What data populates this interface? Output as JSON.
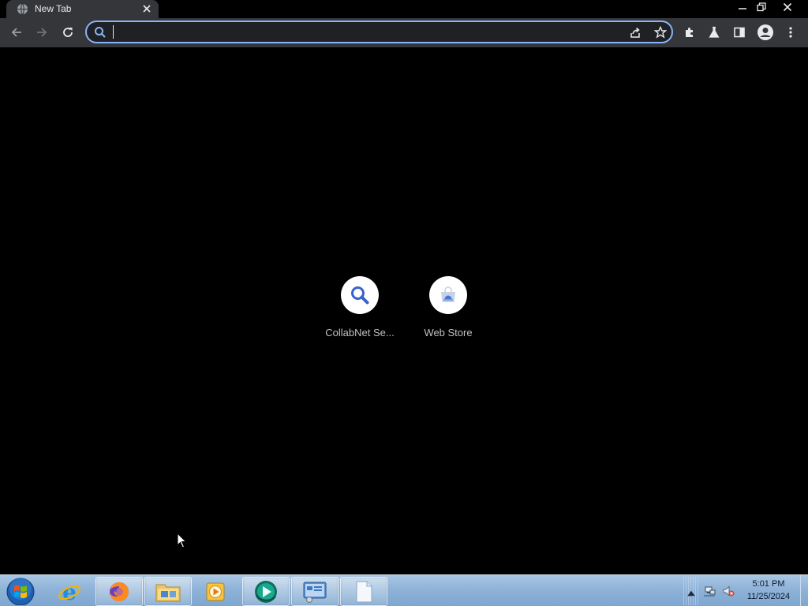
{
  "browser": {
    "tab": {
      "title": "New Tab",
      "close_icon": "close-icon",
      "favicon": "globe-icon"
    },
    "window_controls": [
      "minimize-icon",
      "restore-icon",
      "close-icon"
    ],
    "toolbar": {
      "back_icon": "arrow-left-icon",
      "forward_icon": "arrow-right-icon",
      "reload_icon": "reload-icon",
      "omnibox": {
        "value": "",
        "placeholder": "",
        "leading_icon": "search-icon"
      },
      "share_icon": "share-icon",
      "bookmark_icon": "star-icon",
      "extensions_icon": "puzzle-icon",
      "labs_icon": "flask-icon",
      "side_panel_icon": "side-panel-icon",
      "profile_icon": "avatar-icon",
      "menu_icon": "kebab-menu-icon"
    }
  },
  "new_tab_page": {
    "background": "#000000",
    "shortcuts": [
      {
        "label": "CollabNet Se...",
        "icon": "search-icon"
      },
      {
        "label": "Web Store",
        "icon": "web-store-icon"
      }
    ]
  },
  "taskbar": {
    "start_icon": "windows-start-icon",
    "apps": [
      {
        "name": "internet-explorer",
        "icon": "internet-explorer-icon",
        "open": false
      },
      {
        "name": "firefox",
        "icon": "firefox-icon",
        "open": true
      },
      {
        "name": "file-explorer",
        "icon": "folder-icon",
        "open": true
      },
      {
        "name": "media-player",
        "icon": "media-player-icon",
        "open": false
      },
      {
        "name": "chrome-app",
        "icon": "teal-app-icon",
        "open": true
      },
      {
        "name": "control-panel",
        "icon": "control-panel-icon",
        "open": true
      },
      {
        "name": "blank-document",
        "icon": "document-icon",
        "open": true
      }
    ],
    "tray": {
      "icons": [
        "show-hidden-icons-icon",
        "network-icon",
        "volume-muted-icon"
      ],
      "clock": {
        "time": "5:01 PM",
        "date": "11/25/2024"
      }
    }
  },
  "colors": {
    "accent": "#8ab4f8",
    "toolbar_bg": "#35363a",
    "tab_text": "#e8eaed",
    "shortcut_label": "#bdc1c6",
    "taskbar_bg": "#8fb3d8"
  }
}
